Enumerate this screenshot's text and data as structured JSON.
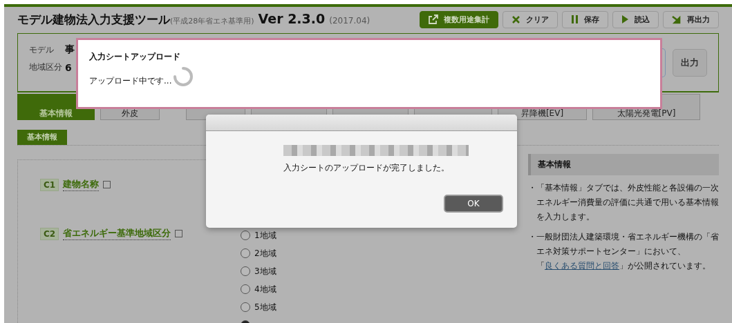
{
  "app": {
    "title": "モデル建物法入力支援ツール",
    "subtitle": "(平成28年省エネ基準用)",
    "version": "Ver 2.3.0",
    "date": "(2017.04)"
  },
  "toolbar": [
    {
      "label": "複数用途集計",
      "kind": "aggregate"
    },
    {
      "label": "クリア",
      "kind": "clear"
    },
    {
      "label": "保存",
      "kind": "save"
    },
    {
      "label": "読込",
      "kind": "load"
    },
    {
      "label": "再出力",
      "kind": "reoutput"
    }
  ],
  "summary": {
    "fields": [
      {
        "label": "モデル",
        "value": "事"
      },
      {
        "label": "地域区分",
        "value": "6"
      }
    ],
    "output_button": "出力"
  },
  "tabs": [
    {
      "label": "基本情報",
      "selected": true
    },
    {
      "label": "外皮",
      "selected": false
    },
    {
      "selected": false
    },
    {
      "selected": false
    },
    {
      "selected": false
    },
    {
      "selected": false
    },
    {
      "label": "昇降機[EV]",
      "selected": false
    },
    {
      "label": "太陽光発電[PV]",
      "selected": false
    }
  ],
  "section_label": "基本情報",
  "items": [
    {
      "code": "C1",
      "label": "建物名称"
    },
    {
      "code": "C2",
      "label": "省エネルギー基準地域区分"
    }
  ],
  "region_options": [
    {
      "label": "1地域",
      "selected": false
    },
    {
      "label": "2地域",
      "selected": false
    },
    {
      "label": "3地域",
      "selected": false
    },
    {
      "label": "4地域",
      "selected": false
    },
    {
      "label": "5地域",
      "selected": false
    },
    {
      "selected": true
    }
  ],
  "help": {
    "title": "基本情報",
    "paragraphs": [
      {
        "marker": "・",
        "text": "「基本情報」タブでは、外皮性能と各設備の一次エネルギー消費量の評価に共通で用いる基本情報を入力します。"
      },
      {
        "marker": "・",
        "text": "一般財団法人建築環境・省エネルギー機構の「省エネ対策サポートセンター」において、「",
        "link": "良くある質問と回答",
        "after": "」が公開されています。"
      }
    ]
  },
  "upload_dialog": {
    "title": "入力シートアップロード",
    "message": "アップロード中です..."
  },
  "alert": {
    "message": "入力シートのアップロードが完了しました。",
    "button": "OK"
  }
}
